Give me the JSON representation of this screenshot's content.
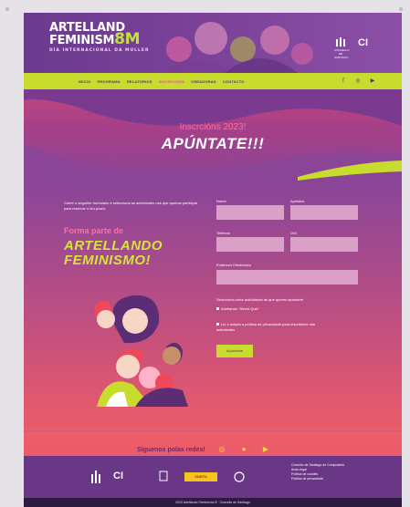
{
  "hero": {
    "logo_line1": "ARTELLAND",
    "logo_line2": "FEMINISM",
    "logo_8m": "8M",
    "logo_sub": "DÍA INTERNACIONAL DA MULLER",
    "sponsor_cim": "CI",
    "sponsor_small": "CONCELLO DE SANTIAGO"
  },
  "nav": {
    "items": [
      "INICIO",
      "PROGRAMA",
      "RELATORIOS",
      "INSCRICIÓNS",
      "CREADORAS",
      "CONTACTO"
    ],
    "active_index": 3,
    "social": [
      "facebook-icon",
      "instagram-icon",
      "youtube-icon"
    ]
  },
  "banner": {
    "kicker": "Inscrcións 2023!",
    "title": "APÚNTATE!!!"
  },
  "main": {
    "intro": "Cubre o seguinte formulario e selecciona as actividades nas que queiras participar para reservar o teu prazo.",
    "forma": "Forma parte de",
    "bigtitle1": "ARTELLANDO",
    "bigtitle2": "FEMINISMO!",
    "labels": {
      "nome": "Nome",
      "apelidos": "Apelidos",
      "telefono": "Teléfono",
      "dni": "DNI",
      "email": "Enderezo Electrónico",
      "select": "Selecciona unha actividades ás que queres apuntarte"
    },
    "checkbox1": "Artellando \"Street Quiz\"",
    "checkbox2": "Lin e acepto a política de privacidade para inscribirme nas actividades",
    "submit": "Apúntome"
  },
  "social": {
    "text": "Síguenos polas redes!",
    "icons": [
      "instagram-icon",
      "facebook-icon",
      "youtube-icon"
    ]
  },
  "footer": {
    "logo_cim": "CI",
    "badge": "XUNTA",
    "links": [
      "Concello de Santiago de Compostela",
      "Aviso legal",
      "Política de cookies",
      "Política de privacidade"
    ],
    "bottom": "2023 Artellando Feminismo 8 · Concello de Santiago"
  },
  "colors": {
    "accent": "#c8dc2e",
    "pink": "#ff6fa0",
    "purple": "#6a3686"
  }
}
